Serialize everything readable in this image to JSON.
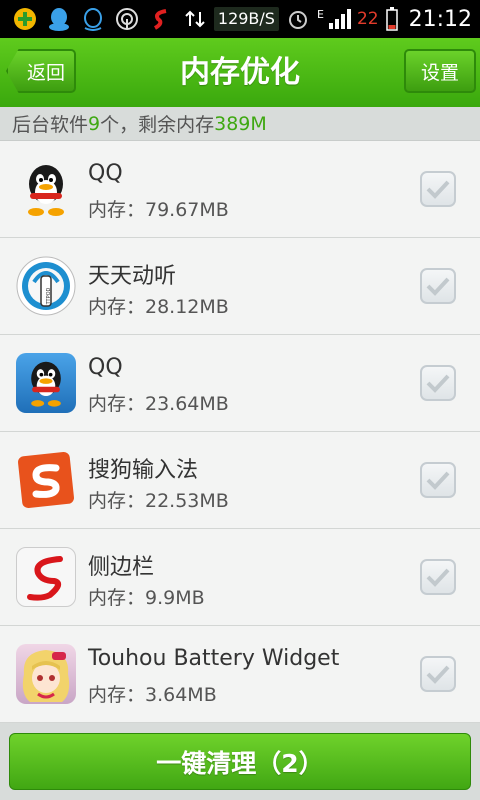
{
  "status_bar": {
    "net_speed": "129B/S",
    "signal_label": "E",
    "battery": "22",
    "time": "21:12"
  },
  "header": {
    "back_label": "返回",
    "title": "内存优化",
    "settings_label": "设置"
  },
  "summary": {
    "prefix": "后台软件",
    "app_count": "9",
    "middle": "个，剩余内存",
    "free_memory": "389M"
  },
  "apps": [
    {
      "name": "QQ",
      "memory": "内存：79.67MB",
      "icon": "qq-penguin-icon"
    },
    {
      "name": "天天动听",
      "memory": "内存：28.12MB",
      "icon": "ttpod-icon"
    },
    {
      "name": "QQ",
      "memory": "内存：23.64MB",
      "icon": "qq-blue-icon"
    },
    {
      "name": "搜狗输入法",
      "memory": "内存：22.53MB",
      "icon": "sogou-icon"
    },
    {
      "name": "侧边栏",
      "memory": "内存：9.9MB",
      "icon": "sidebar-s-icon"
    },
    {
      "name": "Touhou Battery Widget",
      "memory": "内存：3.64MB",
      "icon": "touhou-icon"
    }
  ],
  "bottom": {
    "clean_label": "一键清理（2）"
  },
  "colors": {
    "accent": "#3fa812",
    "header_green": "#4cbb16"
  }
}
